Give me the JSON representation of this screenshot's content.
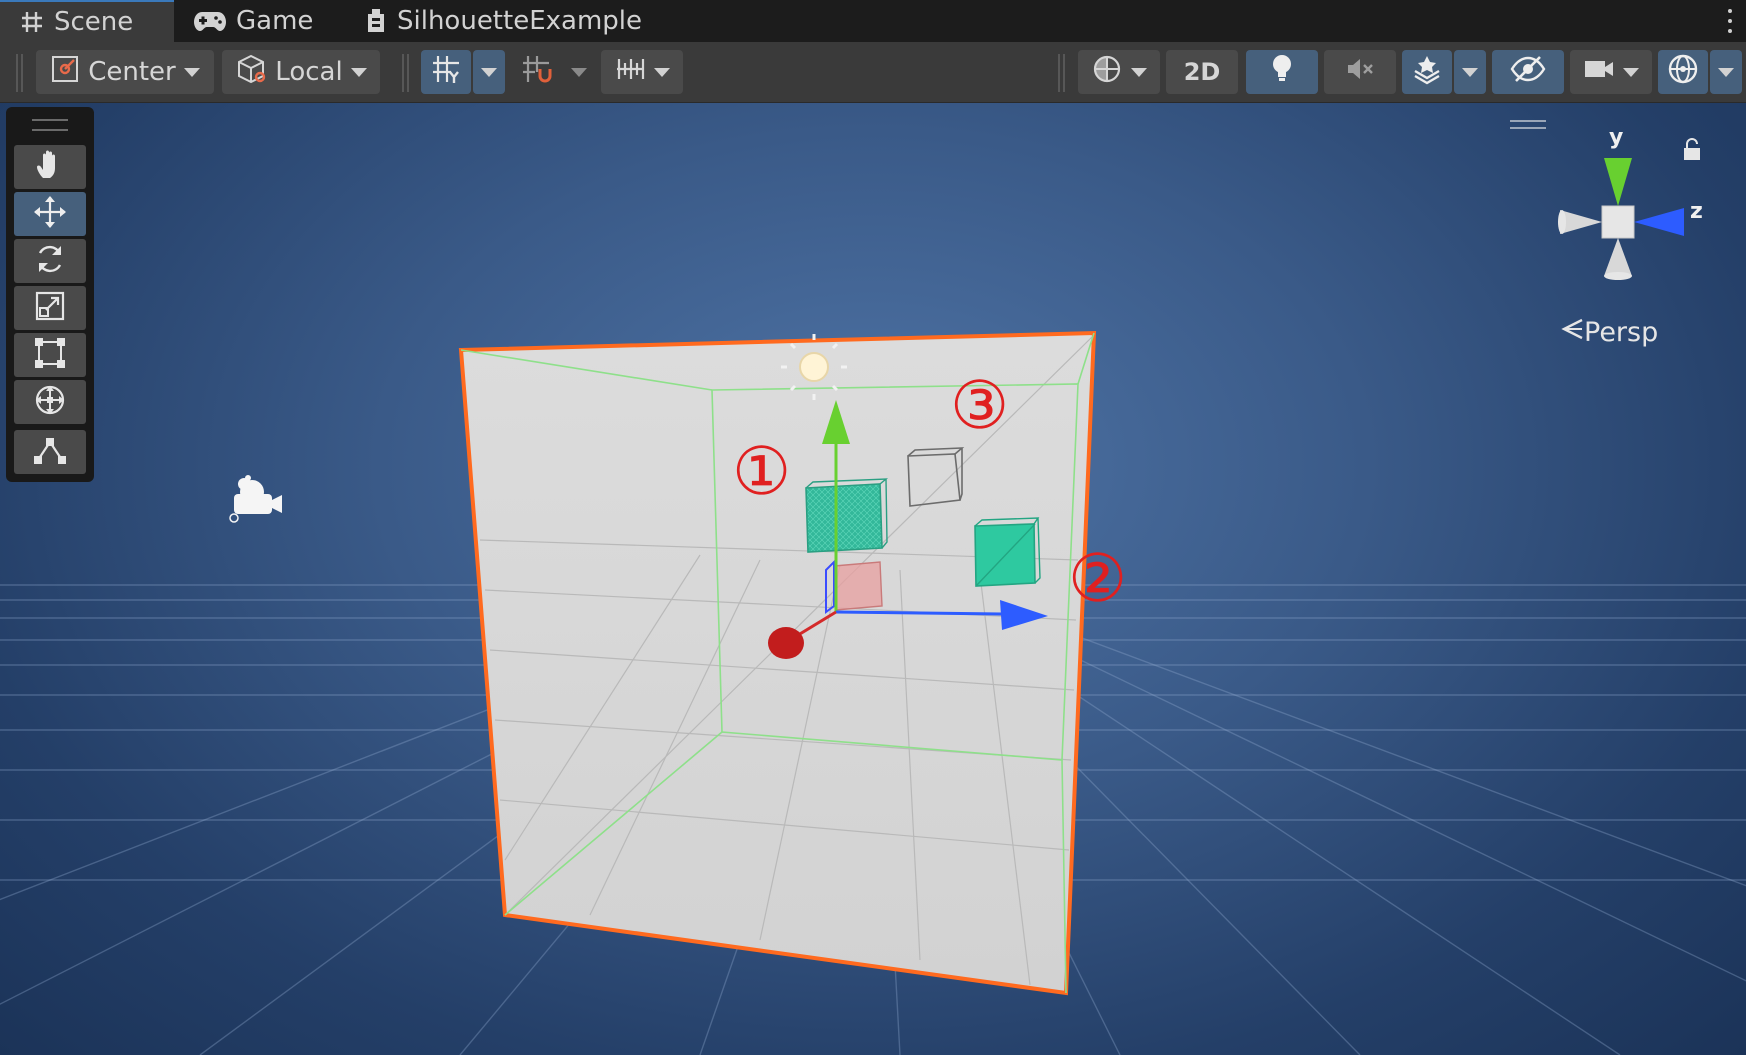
{
  "tabs": [
    {
      "label": "Scene",
      "icon": "grid-hash-icon",
      "active": true
    },
    {
      "label": "Game",
      "icon": "gamepad-icon",
      "active": false
    },
    {
      "label": "SilhouetteExample",
      "icon": "prefab-icon",
      "active": false
    }
  ],
  "toolbar": {
    "pivot_label": "Center",
    "space_label": "Local",
    "mode_2d_label": "2D"
  },
  "gizmo": {
    "y_label": "y",
    "z_label": "z",
    "persp_label": "Persp"
  },
  "annotations": {
    "one": "①",
    "two": "②",
    "three": "③"
  },
  "colors": {
    "selection_outline": "#ff6a1f",
    "axis_x": "#d42a2a",
    "axis_y": "#68d030",
    "axis_z": "#2d5cff",
    "cube_teal": "#2ec9a0",
    "annotation": "#e02020",
    "active_tool": "#46607c"
  }
}
